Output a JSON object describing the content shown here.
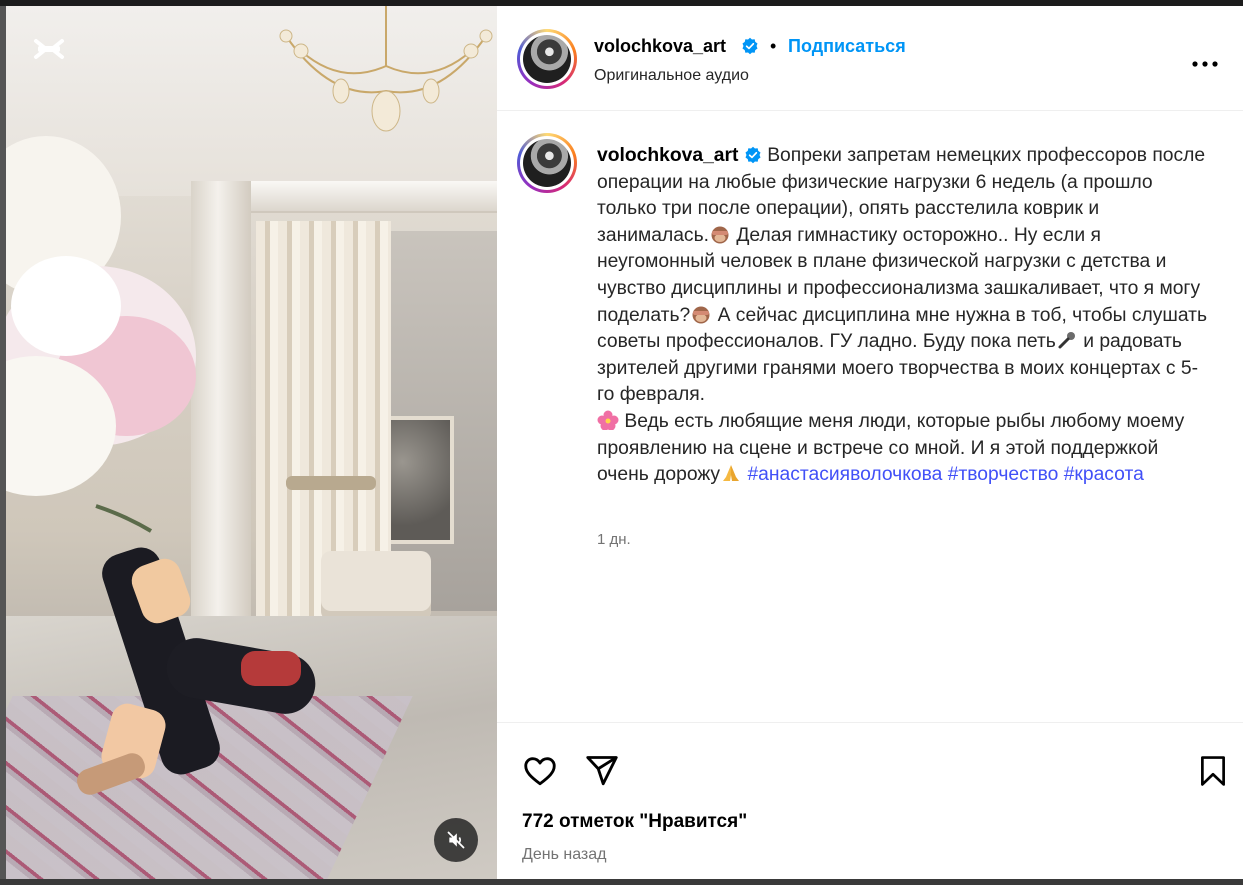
{
  "header": {
    "username": "volochkova_art",
    "follow_label": "Подписаться",
    "audio": "Оригинальное аудио"
  },
  "post": {
    "username": "volochkova_art",
    "caption_parts": [
      "Вопреки запретам немецких профессоров после операции на любые физические нагрузки 6 недель (а прошло только три после операции), опять расстелила коврик и занималась.",
      " Делая гимнастику осторожно.. Ну если я неугомонный человек в плане физической нагрузки с детства и чувство дисциплины и профессионализма зашкаливает, что я могу поделать?",
      " А сейчас дисциплина мне нужна в тоб, чтобы слушать советы профессионалов. ГУ ладно. Буду пока петь",
      " и радовать зрителей другими гранями моего творчества в моих концертах с 5-го февраля.",
      " Ведь есть любящие меня люди, которые рыбы любому моему проявлению на сцене и встрече со мной. И я этой поддержкой очень дорожу"
    ],
    "hashtags": [
      "#анастасияволочкова",
      "#творчество",
      "#красота"
    ],
    "emojis": [
      "see-no-evil-monkey",
      "see-no-evil-monkey",
      "microphone",
      "hibiscus",
      "folded-hands"
    ],
    "time": "1 дн."
  },
  "footer": {
    "likes": "772 отметок \"Нравится\"",
    "posted": "День назад"
  },
  "icons": [
    "capcut-logo-icon",
    "mute-icon",
    "more-options-icon",
    "heart-icon",
    "share-icon",
    "bookmark-icon",
    "verified-badge-icon"
  ],
  "colors": {
    "accent": "#0095f6",
    "hashtag": "#4150f7",
    "verified": "#0095f6"
  }
}
